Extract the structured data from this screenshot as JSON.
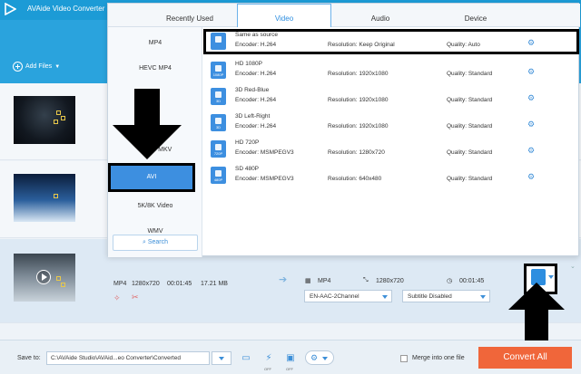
{
  "window": {
    "title": "AVAide Video Converter ("
  },
  "toolbar": {
    "add_files": "Add Files"
  },
  "popup": {
    "tabs": [
      {
        "label": "Recently Used"
      },
      {
        "label": "Video"
      },
      {
        "label": "Audio"
      },
      {
        "label": "Device"
      }
    ],
    "formats": [
      "MP4",
      "HEVC MP4",
      "HEVC MKV",
      "AVI",
      "5K/8K Video",
      "WMV"
    ],
    "selected_format": "AVI",
    "search_label": "Search",
    "presets": [
      {
        "name": "Same as source",
        "encoder": "Encoder: H.264",
        "resolution": "Resolution: Keep Original",
        "quality": "Quality: Auto",
        "badge": ""
      },
      {
        "name": "HD 1080P",
        "encoder": "Encoder: H.264",
        "resolution": "Resolution: 1920x1080",
        "quality": "Quality: Standard",
        "badge": "1080P"
      },
      {
        "name": "3D Red-Blue",
        "encoder": "Encoder: H.264",
        "resolution": "Resolution: 1920x1080",
        "quality": "Quality: Standard",
        "badge": "3D"
      },
      {
        "name": "3D Left-Right",
        "encoder": "Encoder: H.264",
        "resolution": "Resolution: 1920x1080",
        "quality": "Quality: Standard",
        "badge": "3D"
      },
      {
        "name": "HD 720P",
        "encoder": "Encoder: MSMPEGV3",
        "resolution": "Resolution: 1280x720",
        "quality": "Quality: Standard",
        "badge": "720P"
      },
      {
        "name": "SD 480P",
        "encoder": "Encoder: MSMPEGV3",
        "resolution": "Resolution: 640x480",
        "quality": "Quality: Standard",
        "badge": "480P"
      }
    ]
  },
  "active_file": {
    "format": "MP4",
    "resolution": "1280x720",
    "duration": "00:01:45",
    "size": "17.21 MB",
    "out_format": "MP4",
    "out_resolution": "1280x720",
    "out_duration": "00:01:45",
    "audio_track": "EN-AAC-2Channel",
    "subtitle": "Subtitle Disabled"
  },
  "bottom": {
    "save_to": "Save to:",
    "save_path": "C:\\AVAide Studio\\AVAid...eo Converter\\Converted",
    "merge_label": "Merge into one file",
    "convert_all": "Convert All"
  },
  "icons": {
    "off_badge_1": "OFF",
    "off_badge_2": "OFF"
  }
}
